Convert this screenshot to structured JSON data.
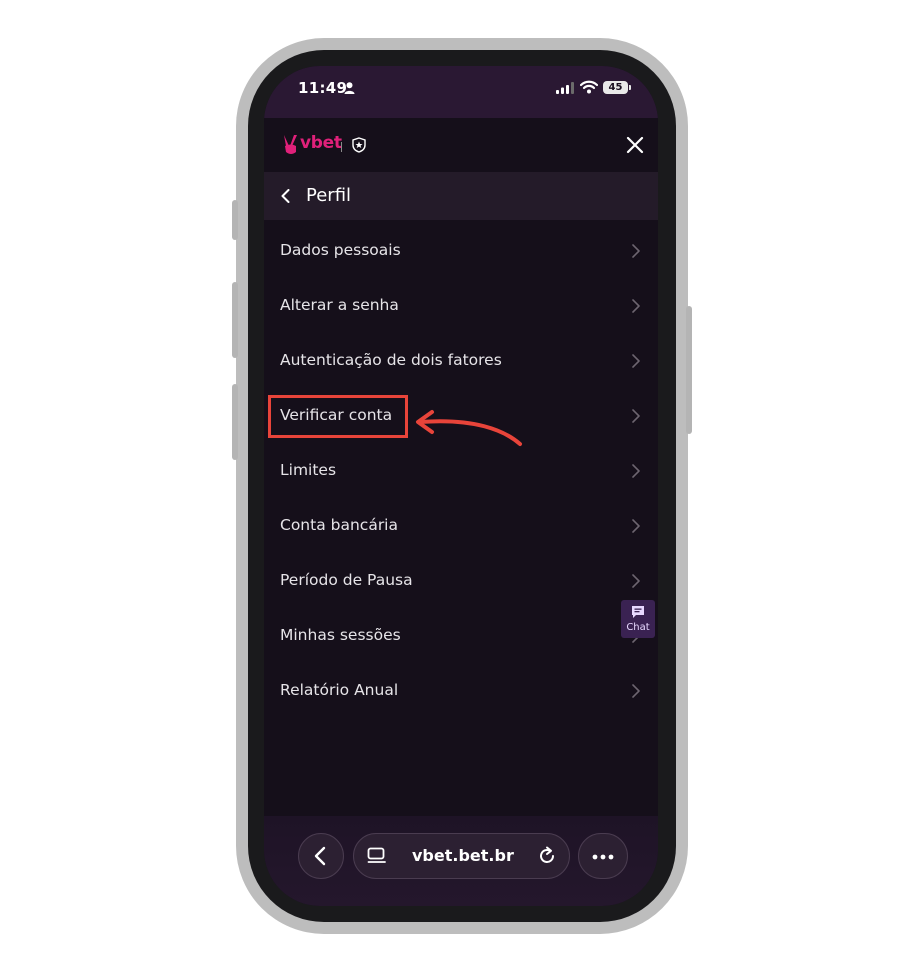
{
  "status_bar": {
    "time": "11:49",
    "battery": "45"
  },
  "header": {
    "logo_text": "vbet"
  },
  "perfil": {
    "title": "Perfil"
  },
  "menu": {
    "items": [
      {
        "label": "Dados pessoais"
      },
      {
        "label": "Alterar a senha"
      },
      {
        "label": "Autenticação de dois fatores"
      },
      {
        "label": "Verificar conta"
      },
      {
        "label": "Limites"
      },
      {
        "label": "Conta bancária"
      },
      {
        "label": "Período de Pausa"
      },
      {
        "label": "Minhas sessões"
      },
      {
        "label": "Relatório Anual"
      }
    ]
  },
  "chat": {
    "label": "Chat"
  },
  "browser": {
    "url": "vbet.bet.br"
  },
  "colors": {
    "brand": "#e0207a",
    "annotation": "#e8443a",
    "background": "#150f1a"
  }
}
